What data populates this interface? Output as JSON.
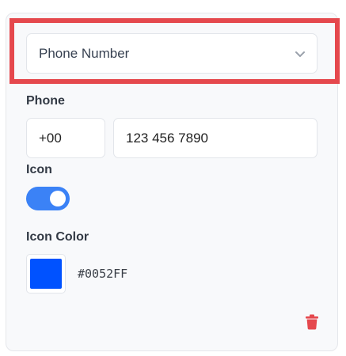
{
  "type_select": {
    "value": "Phone Number",
    "chevron_icon": "chevron-down-icon"
  },
  "phone": {
    "label": "Phone",
    "country_code": "+00",
    "number": "123 456 7890"
  },
  "icon": {
    "label": "Icon",
    "enabled": true
  },
  "icon_color": {
    "label": "Icon Color",
    "hex": "#0052FF"
  },
  "colors": {
    "accent": "#3B82F6",
    "highlight": "#E5484D",
    "delete": "#E5484D"
  },
  "actions": {
    "delete_icon": "trash-icon"
  }
}
